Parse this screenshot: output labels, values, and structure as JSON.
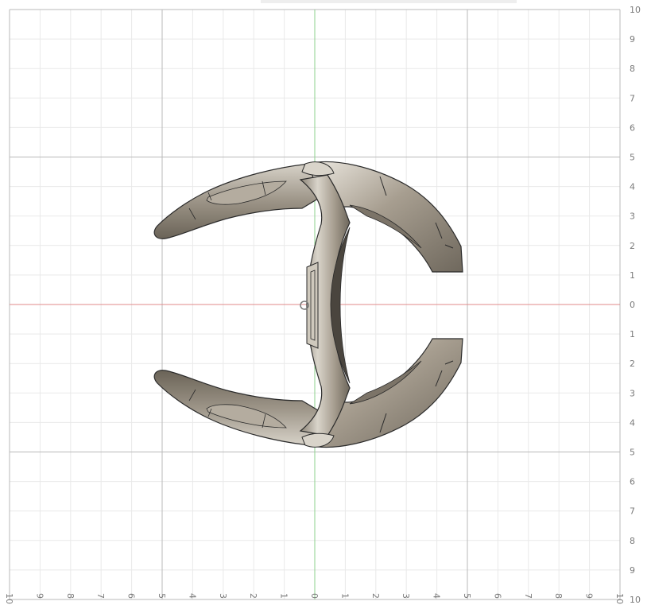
{
  "viewport": {
    "title": "",
    "grid": {
      "range": [
        -10,
        10
      ],
      "major_step": 5,
      "minor_step": 1,
      "right_labels": [
        "10",
        "9",
        "8",
        "7",
        "6",
        "5",
        "4",
        "3",
        "2",
        "1",
        "0",
        "1",
        "2",
        "3",
        "4",
        "5",
        "6",
        "7",
        "8",
        "9",
        "10"
      ],
      "bottom_labels": [
        "10",
        "9",
        "8",
        "7",
        "6",
        "5",
        "4",
        "3",
        "2",
        "1",
        "0",
        "1",
        "2",
        "3",
        "4",
        "5",
        "6",
        "7",
        "8",
        "9",
        "10"
      ]
    },
    "colors": {
      "background": "#ffffff",
      "minor_grid": "#e9e9e9",
      "major_grid": "#b9b9b9",
      "x_axis": "#e08a8a",
      "y_axis": "#8ed08e",
      "model_fill": "#9a9183",
      "model_highlight": "#e8e4dc",
      "model_edge": "#2b2b2b"
    },
    "model": {
      "name_icon": "starship-hull-3d-model",
      "origin_marker_icon": "origin-circle-icon"
    }
  }
}
